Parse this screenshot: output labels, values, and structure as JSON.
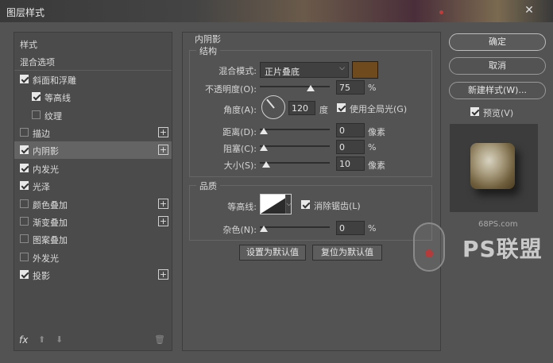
{
  "window": {
    "title": "图层样式",
    "close_glyph": "✕"
  },
  "left": {
    "items": [
      {
        "label": "样式",
        "checkbox": null,
        "checked": false,
        "plus": false,
        "selected": false,
        "indent": 0
      },
      {
        "label": "混合选项",
        "checkbox": null,
        "checked": false,
        "plus": false,
        "selected": false,
        "indent": 0
      },
      {
        "label": "斜面和浮雕",
        "checkbox": true,
        "checked": true,
        "plus": false,
        "selected": false,
        "indent": 0
      },
      {
        "label": "等高线",
        "checkbox": true,
        "checked": true,
        "plus": false,
        "selected": false,
        "indent": 1
      },
      {
        "label": "纹理",
        "checkbox": true,
        "checked": false,
        "plus": false,
        "selected": false,
        "indent": 1
      },
      {
        "label": "描边",
        "checkbox": true,
        "checked": false,
        "plus": true,
        "selected": false,
        "indent": 0
      },
      {
        "label": "内阴影",
        "checkbox": true,
        "checked": true,
        "plus": true,
        "selected": true,
        "indent": 0
      },
      {
        "label": "内发光",
        "checkbox": true,
        "checked": true,
        "plus": false,
        "selected": false,
        "indent": 0
      },
      {
        "label": "光泽",
        "checkbox": true,
        "checked": true,
        "plus": false,
        "selected": false,
        "indent": 0
      },
      {
        "label": "颜色叠加",
        "checkbox": true,
        "checked": false,
        "plus": true,
        "selected": false,
        "indent": 0
      },
      {
        "label": "渐变叠加",
        "checkbox": true,
        "checked": false,
        "plus": true,
        "selected": false,
        "indent": 0
      },
      {
        "label": "图案叠加",
        "checkbox": true,
        "checked": false,
        "plus": false,
        "selected": false,
        "indent": 0
      },
      {
        "label": "外发光",
        "checkbox": true,
        "checked": false,
        "plus": false,
        "selected": false,
        "indent": 0
      },
      {
        "label": "投影",
        "checkbox": true,
        "checked": true,
        "plus": true,
        "selected": false,
        "indent": 0
      }
    ],
    "fx_label": "fx",
    "up_glyph": "⬆",
    "down_glyph": "⬇",
    "trash_glyph": "🗑"
  },
  "panel": {
    "section_title": "内阴影",
    "structure": {
      "title": "结构",
      "blend_mode_label": "混合模式:",
      "blend_mode_value": "正片叠底",
      "shadow_color": "#6e4a1c",
      "opacity_label": "不透明度(O):",
      "opacity_value": "75",
      "opacity_pct": 0.75,
      "opacity_unit": "%",
      "angle_label": "角度(A):",
      "angle_value": "120",
      "angle_unit": "度",
      "global_light_label": "使用全局光(G)",
      "global_light_checked": true,
      "distance_label": "距离(D):",
      "distance_value": "0",
      "distance_pct": 0.0,
      "distance_unit": "像素",
      "choke_label": "阻塞(C):",
      "choke_value": "0",
      "choke_pct": 0.0,
      "choke_unit": "%",
      "size_label": "大小(S):",
      "size_value": "10",
      "size_pct": 0.04,
      "size_unit": "像素"
    },
    "quality": {
      "title": "品质",
      "contour_label": "等高线:",
      "antialias_label": "消除锯齿(L)",
      "antialias_checked": true,
      "noise_label": "杂色(N):",
      "noise_value": "0",
      "noise_pct": 0.0,
      "noise_unit": "%"
    },
    "set_default_label": "设置为默认值",
    "reset_default_label": "复位为默认值"
  },
  "right": {
    "ok_label": "确定",
    "cancel_label": "取消",
    "new_style_label": "新建样式(W)...",
    "preview_label": "预览(V)",
    "preview_checked": true
  },
  "watermark": {
    "site": "68PS.com",
    "brand": "PS联盟"
  }
}
